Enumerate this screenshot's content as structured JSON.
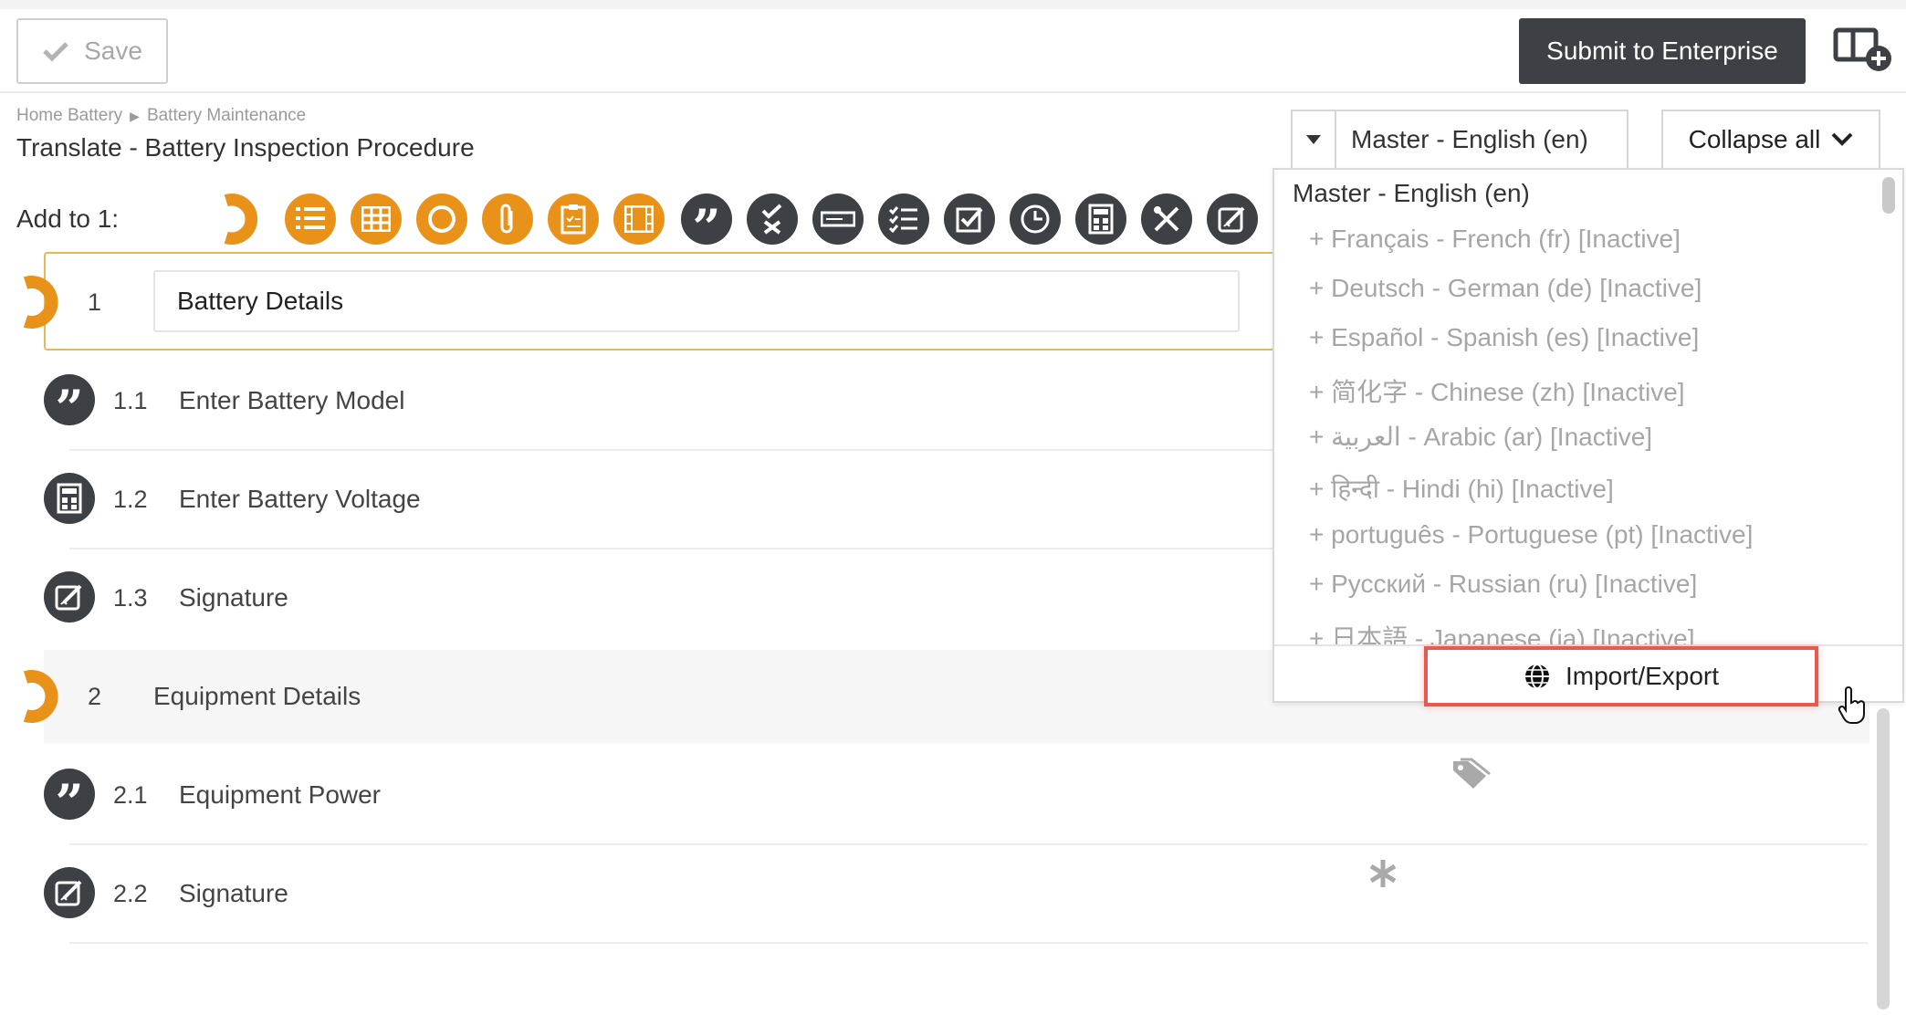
{
  "toolbar": {
    "save_label": "Save",
    "submit_label": "Submit to Enterprise"
  },
  "breadcrumb": {
    "items": [
      "Home Battery",
      "Battery Maintenance"
    ]
  },
  "page_title": "Translate - Battery Inspection Procedure",
  "language_select": {
    "value": "Master - English (en)"
  },
  "collapse_label": "Collapse all",
  "add_to": {
    "label": "Add to 1:",
    "tools": [
      {
        "icon": "section-icon",
        "color": "#e8921a"
      },
      {
        "icon": "numbered-list-icon",
        "color": "#e8921a"
      },
      {
        "icon": "table-icon",
        "color": "#e8921a"
      },
      {
        "icon": "circle-icon",
        "color": "#e8921a"
      },
      {
        "icon": "attachment-icon",
        "color": "#e8921a"
      },
      {
        "icon": "clipboard-checklist-icon",
        "color": "#e8921a"
      },
      {
        "icon": "film-icon",
        "color": "#e8921a"
      },
      {
        "icon": "quote-icon",
        "color": "#3d4044"
      },
      {
        "icon": "check-cross-icon",
        "color": "#3d4044"
      },
      {
        "icon": "input-field-icon",
        "color": "#3d4044"
      },
      {
        "icon": "checklist-icon",
        "color": "#3d4044"
      },
      {
        "icon": "checkbox-icon",
        "color": "#3d4044"
      },
      {
        "icon": "clock-icon",
        "color": "#3d4044"
      },
      {
        "icon": "calculator-icon",
        "color": "#3d4044"
      },
      {
        "icon": "tools-icon",
        "color": "#3d4044"
      },
      {
        "icon": "signature-icon",
        "color": "#3d4044"
      }
    ]
  },
  "steps": [
    {
      "num": "1",
      "label": "Battery Details",
      "type": "section"
    },
    {
      "num": "1.1",
      "label": "Enter Battery Model",
      "icon": "quote-icon"
    },
    {
      "num": "1.2",
      "label": "Enter Battery Voltage",
      "icon": "calculator-icon"
    },
    {
      "num": "1.3",
      "label": "Signature",
      "icon": "signature-icon"
    },
    {
      "num": "2",
      "label": "Equipment Details",
      "type": "section"
    },
    {
      "num": "2.1",
      "label": "Equipment Power",
      "icon": "quote-icon"
    },
    {
      "num": "2.2",
      "label": "Signature",
      "icon": "signature-icon"
    }
  ],
  "dropdown": {
    "header": "Master - English (en)",
    "items": [
      "+ Français - French (fr) [Inactive]",
      "+ Deutsch - German (de) [Inactive]",
      "+ Español - Spanish (es) [Inactive]",
      "+ 简化字 - Chinese (zh) [Inactive]",
      "+ العربية - Arabic (ar) [Inactive]",
      "+ हिन्दी - Hindi (hi) [Inactive]",
      "+ português - Portuguese (pt) [Inactive]",
      "+ Русский - Russian (ru) [Inactive]",
      "+ 日本語 - Japanese (ja) [Inactive]"
    ],
    "import_label": "Import/Export"
  },
  "colors": {
    "accent_orange": "#e8921a",
    "dark_icon": "#3d4044",
    "highlight_red": "#e85a50"
  }
}
